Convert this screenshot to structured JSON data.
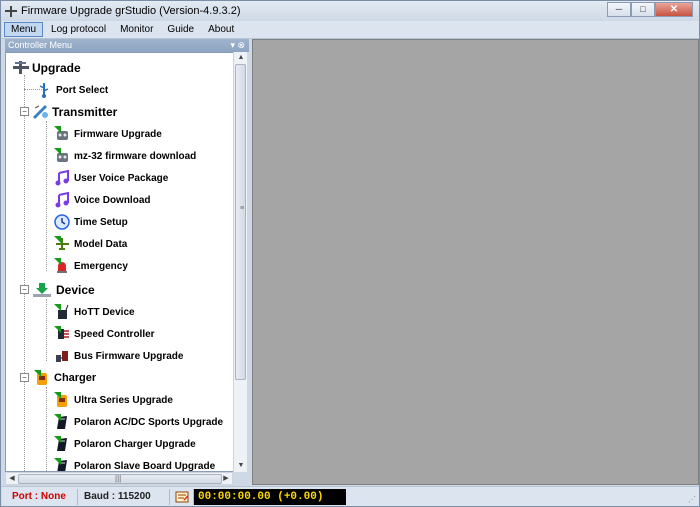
{
  "window": {
    "title": "Firmware Upgrade grStudio (Version-4.9.3.2)"
  },
  "menu": [
    "Menu",
    "Log protocol",
    "Monitor",
    "Guide",
    "About"
  ],
  "panel": {
    "title": "Controller Menu"
  },
  "tree": {
    "upgrade": {
      "label": "Upgrade",
      "icon": "airplane-icon"
    },
    "port_select": {
      "label": "Port Select",
      "icon": "usb-icon"
    },
    "transmitter": {
      "label": "Transmitter",
      "icon": "satellite-icon"
    },
    "transmitter_items": [
      {
        "label": "Firmware Upgrade",
        "icon": "transmitter-icon"
      },
      {
        "label": "mz-32 firmware download",
        "icon": "transmitter-icon"
      },
      {
        "label": "User Voice Package",
        "icon": "music-note-icon"
      },
      {
        "label": "Voice Download",
        "icon": "music-note-icon"
      },
      {
        "label": "Time Setup",
        "icon": "clock-icon"
      },
      {
        "label": "Model Data",
        "icon": "airplane-icon"
      },
      {
        "label": "Emergency",
        "icon": "alarm-light-icon"
      }
    ],
    "device": {
      "label": "Device",
      "icon": "download-tray-icon"
    },
    "device_items": [
      {
        "label": "HoTT Device",
        "icon": "receiver-icon"
      },
      {
        "label": "Speed Controller",
        "icon": "speed-controller-icon"
      },
      {
        "label": "Bus Firmware Upgrade",
        "icon": "bus-device-icon"
      }
    ],
    "charger": {
      "label": "Charger",
      "icon": "charger-icon"
    },
    "charger_items": [
      {
        "label": "Ultra Series Upgrade",
        "icon": "charger-icon"
      },
      {
        "label": "Polaron AC/DC Sports Upgrade",
        "icon": "polaron-icon"
      },
      {
        "label": "Polaron Charger Upgrade",
        "icon": "polaron-icon"
      },
      {
        "label": "Polaron Slave Board Upgrade",
        "icon": "polaron-icon"
      }
    ]
  },
  "status": {
    "port": "Port : None",
    "baud": "Baud : 115200",
    "timer": "00:00:00.00    (+0.00)"
  },
  "colors": {
    "port_text": "#d00000",
    "timer_text": "#ffd800",
    "timer_bg": "#000000",
    "content_bg": "#a5a5a5"
  }
}
